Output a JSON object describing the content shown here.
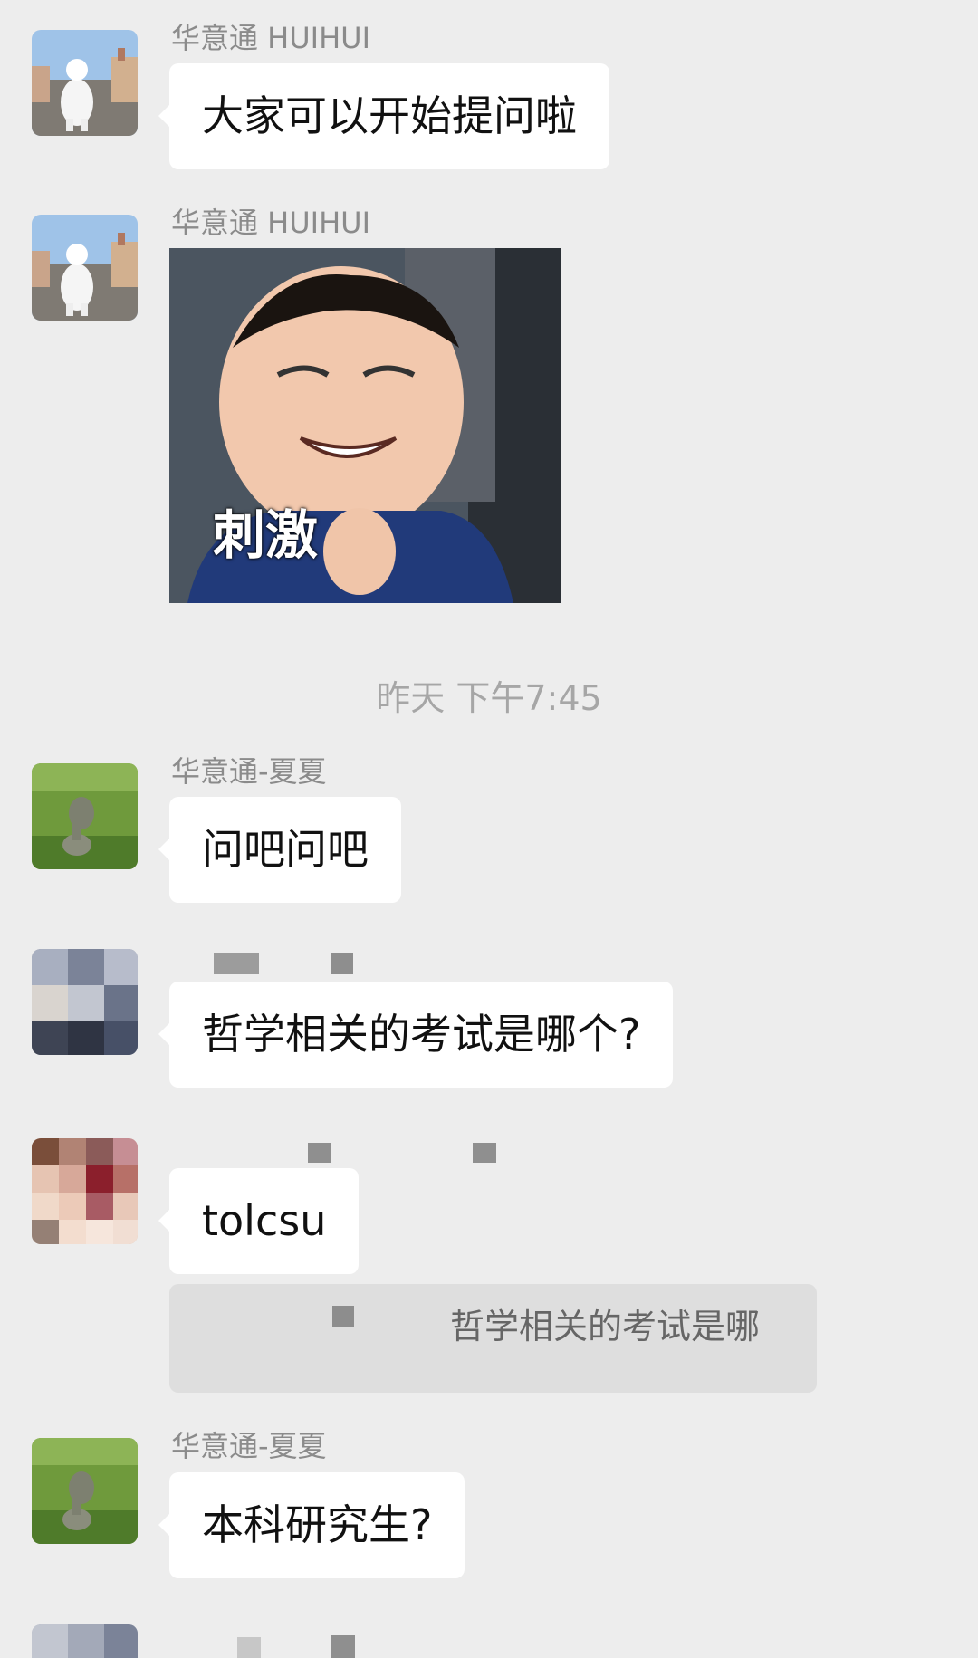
{
  "messages": [
    {
      "sender": "华意通 HUIHUI",
      "text": "大家可以开始提问啦"
    },
    {
      "sender": "华意通 HUIHUI",
      "sticker_caption": "刺激"
    },
    {
      "sender": "华意通-夏夏",
      "text": "问吧问吧"
    },
    {
      "sender": "",
      "text": "哲学相关的考试是哪个?"
    },
    {
      "sender": "",
      "text": "tolcsu",
      "quote": "哲学相关的考试是哪"
    },
    {
      "sender": "华意通-夏夏",
      "text": "本科研究生?"
    }
  ],
  "timestamp": "昨天 下午7:45",
  "icons": {
    "avatar_1": "polar-bear-avatar-icon",
    "avatar_2": "lawn-statue-avatar-icon",
    "avatar_3": "pixelated-avatar-icon"
  },
  "colors": {
    "background": "#ededed",
    "bubble": "#ffffff",
    "sender_text": "#8b8b8b",
    "timestamp_text": "#a6a6a6"
  }
}
